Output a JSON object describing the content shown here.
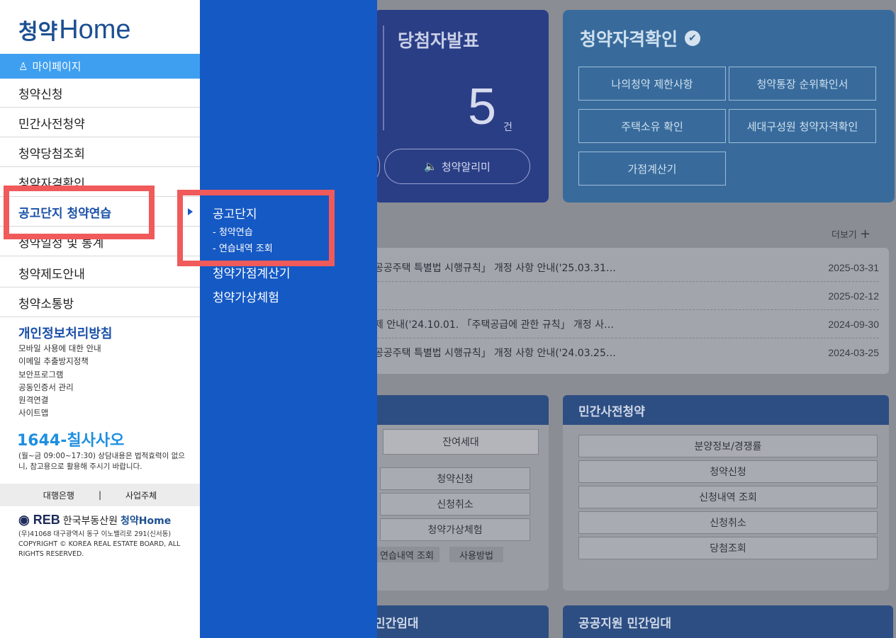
{
  "background": {
    "winners": {
      "title": "당첨자발표",
      "count": "5",
      "unit": "건",
      "alert_button": "청약알리미"
    },
    "qualification": {
      "title": "청약자격확인",
      "buttons": [
        "나의청약 제한사항",
        "청약통장 순위확인서",
        "주택소유 확인",
        "세대구성원 청약자격확인",
        "가점계산기"
      ]
    },
    "notices": {
      "more_label": "더보기",
      "rows": [
        {
          "text": "공공주택 특별법 시행규칙」 개정 사항 안내('25.03.31…",
          "date": "2025-03-31"
        },
        {
          "text": "",
          "date": "2025-02-12"
        },
        {
          "text": "제 안내('24.10.01. 「주택공급에 관한 규칙」 개정 사…",
          "date": "2024-09-30"
        },
        {
          "text": "공공주택 특별법 시행규칙」 개정 사항 안내('24.03.25…",
          "date": "2024-03-25"
        }
      ]
    },
    "apply_panel": {
      "tab": "잔여세대",
      "buttons": [
        "청약신청",
        "신청취소",
        "청약가상체험"
      ],
      "tags": [
        "연습내역 조회",
        "사용방법"
      ]
    },
    "private_panel": {
      "title": "민간사전청약",
      "buttons": [
        "분양정보/경쟁률",
        "청약신청",
        "신청내역 조회",
        "신청취소",
        "당첨조회"
      ]
    },
    "bottom_left_title": "민간임대",
    "bottom_right_title": "공공지원 민간임대"
  },
  "drawer": {
    "logo_korean": "청약",
    "logo_english": "Home",
    "mypage": "마이페이지",
    "menu": [
      "청약신청",
      "민간사전청약",
      "청약당첨조회",
      "청약자격확인",
      "공고단지 청약연습",
      "청약일정 및 통계",
      "청약제도안내",
      "청약소통방"
    ],
    "policy_title": "개인정보처리방침",
    "links": [
      "모바일 사용에 대한 안내",
      "이메일 추출방지정책",
      "보안프로그램",
      "공동인증서 관리",
      "원격연결",
      "사이트맵"
    ],
    "phone": "1644-칠사사오",
    "phone_note": "(월~금 09:00~17:30) 상담내용은 법적효력이 없으니, 참고용으로 활용해 주시기 바랍니다.",
    "bank": "대행은행",
    "separator": "|",
    "company": "사업주체",
    "footer_org": "한국부동산원",
    "footer_brand": "청약Home",
    "footer_reb": "REB",
    "footer_address": "(우)41068 대구광역시 동구 이노밸리로 291(신서동)",
    "footer_copyright": "COPYRIGHT © KOREA REAL ESTATE BOARD, ALL RIGHTS RESERVED."
  },
  "submenu": {
    "items": [
      {
        "label": "공고단지",
        "children": [
          "- 청약연습",
          "- 연습내역 조회"
        ]
      },
      {
        "label": "청약가점계산기"
      },
      {
        "label": "청약가상체험"
      }
    ]
  },
  "colors": {
    "brand_blue": "#1559c4",
    "mypage_blue": "#3e9ff0",
    "highlight_red": "#f05a5a"
  }
}
